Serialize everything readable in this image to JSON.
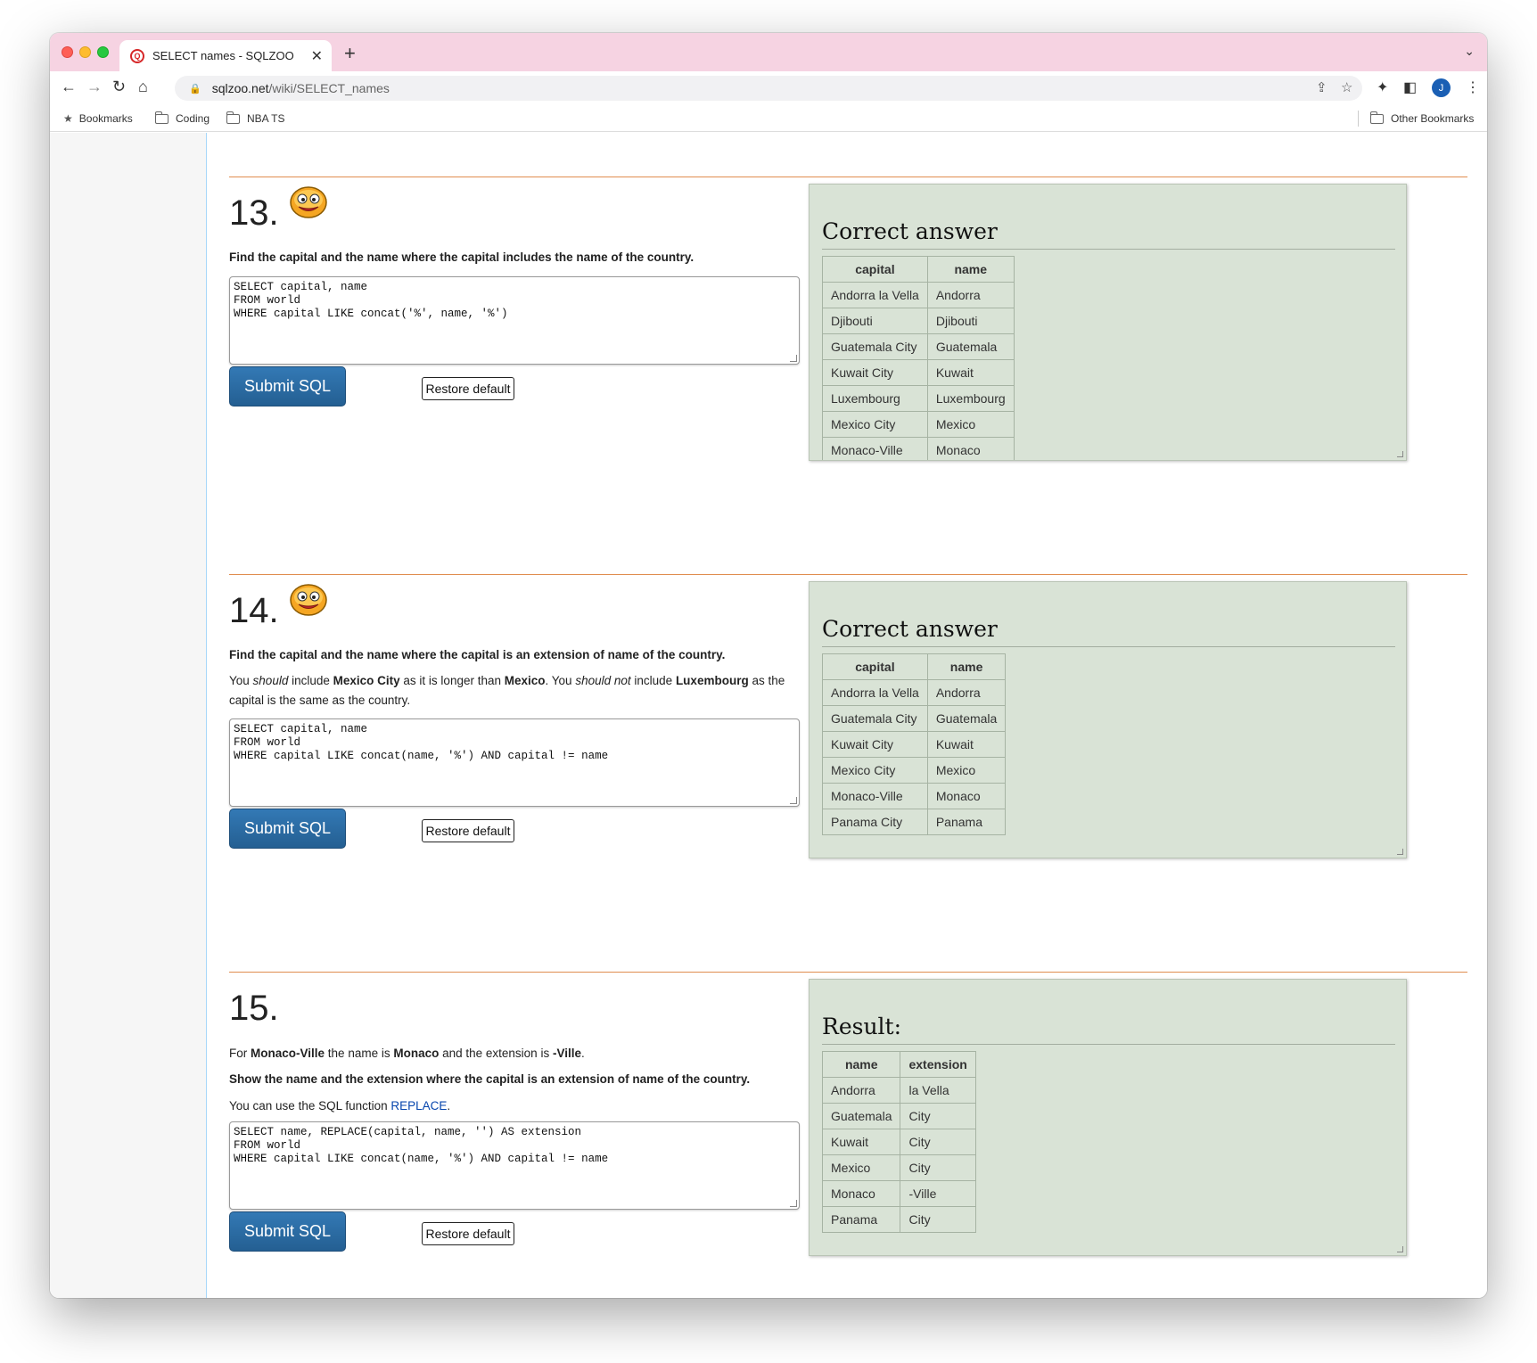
{
  "browser": {
    "tab_title": "SELECT names - SQLZOO",
    "favicon_letter": "Q",
    "url_host": "sqlzoo.net",
    "url_path": "/wiki/SELECT_names",
    "avatar_letter": "J",
    "bookmarks": [
      "Bookmarks",
      "Coding",
      "NBA TS"
    ],
    "other_bookmarks": "Other Bookmarks",
    "icons": [
      "back-icon",
      "forward-icon",
      "reload-icon",
      "home-icon",
      "lock-icon",
      "share-icon",
      "star-icon",
      "extensions-icon",
      "sidepanel-icon",
      "menu-icon"
    ]
  },
  "questions": [
    {
      "number": "13.",
      "show_smiley": true,
      "instruction": "Find the capital and the name where the capital includes the name of the country.",
      "sql": "SELECT capital, name\nFROM world\nWHERE capital LIKE concat('%', name, '%')",
      "submit_label": "Submit SQL",
      "restore_label": "Restore default",
      "answer_title": "Correct answer",
      "columns": [
        "capital",
        "name"
      ],
      "rows": [
        [
          "Andorra la Vella",
          "Andorra"
        ],
        [
          "Djibouti",
          "Djibouti"
        ],
        [
          "Guatemala City",
          "Guatemala"
        ],
        [
          "Kuwait City",
          "Kuwait"
        ],
        [
          "Luxembourg",
          "Luxembourg"
        ],
        [
          "Mexico City",
          "Mexico"
        ],
        [
          "Monaco-Ville",
          "Monaco"
        ]
      ]
    },
    {
      "number": "14.",
      "show_smiley": true,
      "instruction": "Find the capital and the name where the capital is an extension of name of the country.",
      "note": {
        "p1": "You ",
        "i1": "should",
        "p2": " include ",
        "b1": "Mexico City",
        "p3": " as it is longer than ",
        "b2": "Mexico",
        "p4": ". You ",
        "i2": "should not",
        "p5": " include ",
        "b3": "Luxembourg",
        "p6": " as the capital is the same as the country."
      },
      "sql": "SELECT capital, name\nFROM world\nWHERE capital LIKE concat(name, '%') AND capital != name",
      "submit_label": "Submit SQL",
      "restore_label": "Restore default",
      "answer_title": "Correct answer",
      "columns": [
        "capital",
        "name"
      ],
      "rows": [
        [
          "Andorra la Vella",
          "Andorra"
        ],
        [
          "Guatemala City",
          "Guatemala"
        ],
        [
          "Kuwait City",
          "Kuwait"
        ],
        [
          "Mexico City",
          "Mexico"
        ],
        [
          "Monaco-Ville",
          "Monaco"
        ],
        [
          "Panama City",
          "Panama"
        ]
      ]
    },
    {
      "number": "15.",
      "show_smiley": false,
      "intro": {
        "p1": "For ",
        "b1": "Monaco-Ville",
        "p2": " the name is ",
        "b2": "Monaco",
        "p3": " and the extension is ",
        "b3": "-Ville",
        "p4": "."
      },
      "instruction": "Show the name and the extension where the capital is an extension of name of the country.",
      "hint": {
        "p1": "You can use the SQL function ",
        "link": "REPLACE",
        "p2": "."
      },
      "sql": "SELECT name, REPLACE(capital, name, '') AS extension\nFROM world\nWHERE capital LIKE concat(name, '%') AND capital != name",
      "submit_label": "Submit SQL",
      "restore_label": "Restore default",
      "answer_title": "Result:",
      "columns": [
        "name",
        "extension"
      ],
      "rows": [
        [
          "Andorra",
          "la Vella"
        ],
        [
          "Guatemala",
          "City"
        ],
        [
          "Kuwait",
          "City"
        ],
        [
          "Mexico",
          "City"
        ],
        [
          "Monaco",
          "-Ville"
        ],
        [
          "Panama",
          "City"
        ]
      ]
    }
  ]
}
